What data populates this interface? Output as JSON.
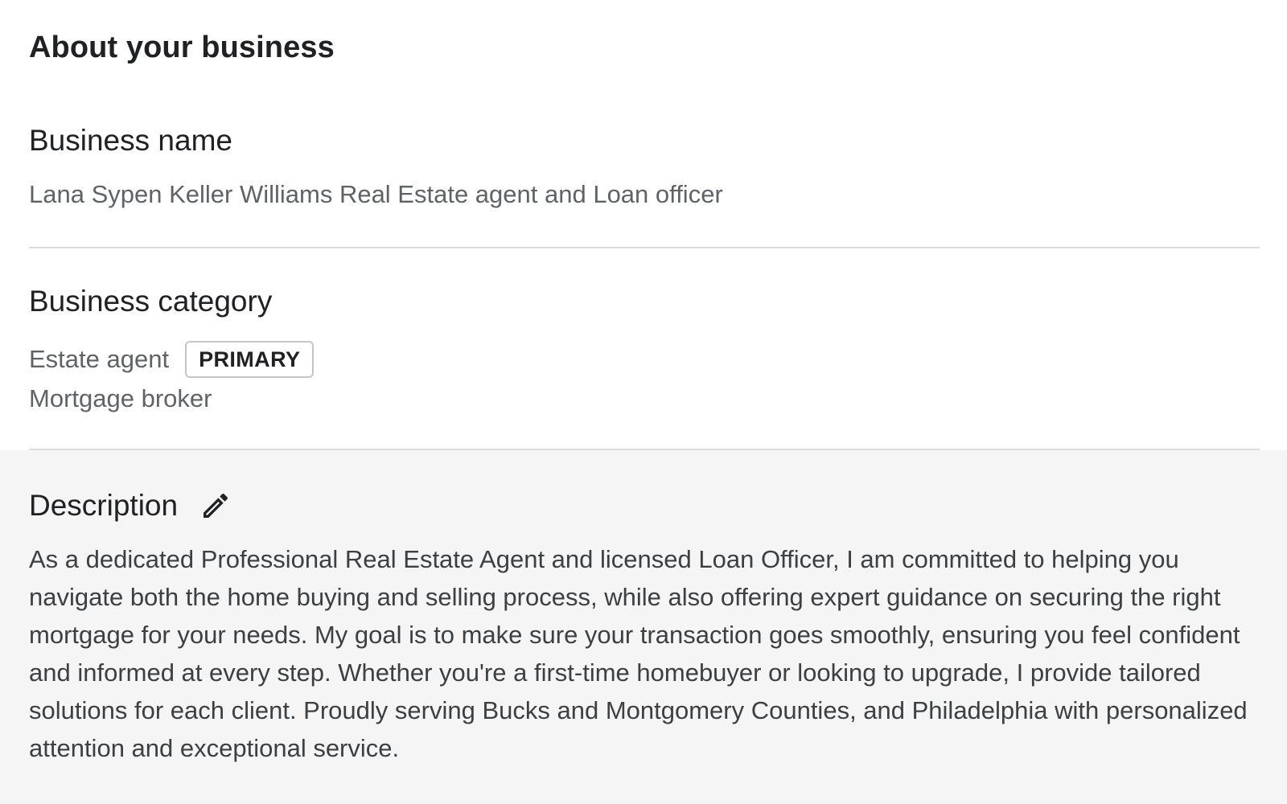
{
  "section": {
    "title": "About your business"
  },
  "business_name": {
    "label": "Business name",
    "value": "Lana Sypen Keller Williams Real Estate agent and Loan officer"
  },
  "business_category": {
    "label": "Business category",
    "primary": "Estate agent",
    "primary_badge": "PRIMARY",
    "secondary": "Mortgage broker"
  },
  "description": {
    "label": "Description",
    "edit_icon": "pencil-icon",
    "text": "As a dedicated Professional Real Estate Agent and licensed Loan Officer, I am committed to helping you navigate both the home buying and selling process, while also offering expert guidance on securing the right mortgage for your needs. My goal is to make sure your transaction goes smoothly, ensuring you feel confident and informed at every step. Whether you're a first-time homebuyer or looking to upgrade, I provide tailored solutions for each client. Proudly serving Bucks and Montgomery Counties, and Philadelphia with personalized attention and exceptional service."
  },
  "colors": {
    "text_primary": "#202124",
    "text_secondary": "#5f6368",
    "divider": "#dadce0",
    "description_background": "#f5f5f5"
  }
}
